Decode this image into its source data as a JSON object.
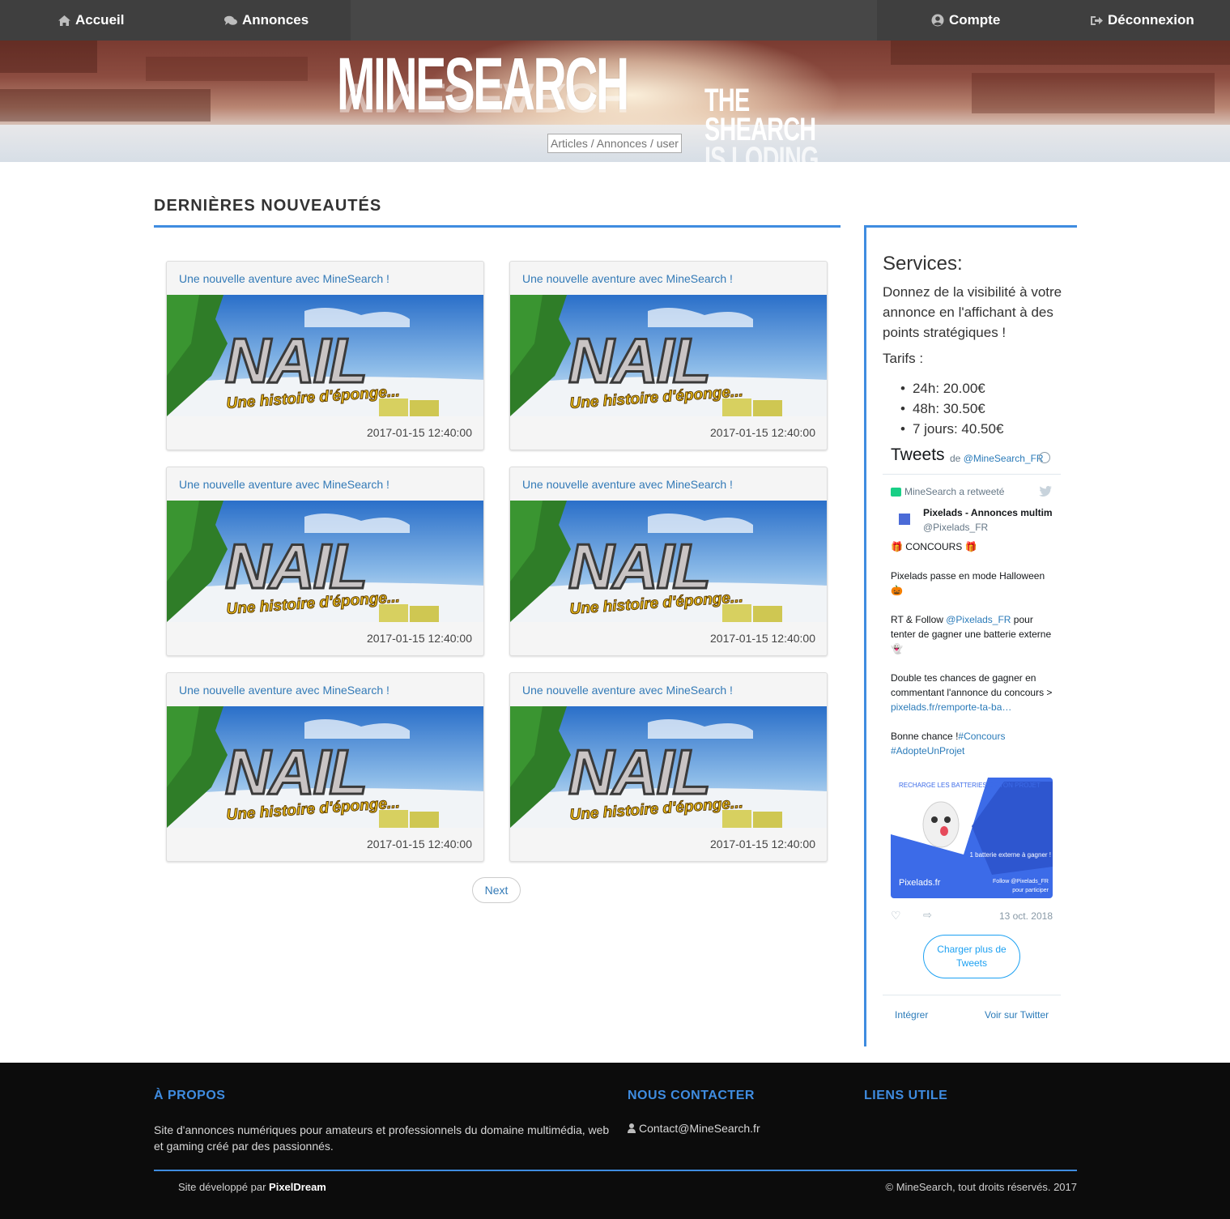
{
  "nav": {
    "home": "Accueil",
    "annonces": "Annonces",
    "compte": "Compte",
    "logout": "Déconnexion"
  },
  "banner": {
    "logo": "MINESEARCH",
    "tagline_1": "THE",
    "tagline_2": "SHEARCH",
    "tagline_3": "IS LODING...",
    "search_placeholder": "Articles / Annonces / user"
  },
  "main": {
    "section_title": "DERNIÈRES NOUVEAUTÉS",
    "cards": [
      {
        "title": "Une nouvelle aventure avec MineSearch !",
        "image_title": "NAIL",
        "image_subtitle": "Une histoire d'éponge...",
        "date": "2017-01-15 12:40:00"
      },
      {
        "title": "Une nouvelle aventure avec MineSearch !",
        "image_title": "NAIL",
        "image_subtitle": "Une histoire d'éponge...",
        "date": "2017-01-15 12:40:00"
      },
      {
        "title": "Une nouvelle aventure avec MineSearch !",
        "image_title": "NAIL",
        "image_subtitle": "Une histoire d'éponge...",
        "date": "2017-01-15 12:40:00"
      },
      {
        "title": "Une nouvelle aventure avec MineSearch !",
        "image_title": "NAIL",
        "image_subtitle": "Une histoire d'éponge...",
        "date": "2017-01-15 12:40:00"
      },
      {
        "title": "Une nouvelle aventure avec MineSearch !",
        "image_title": "NAIL",
        "image_subtitle": "Une histoire d'éponge...",
        "date": "2017-01-15 12:40:00"
      },
      {
        "title": "Une nouvelle aventure avec MineSearch !",
        "image_title": "NAIL",
        "image_subtitle": "Une histoire d'éponge...",
        "date": "2017-01-15 12:40:00"
      }
    ],
    "next_label": "Next"
  },
  "sidebar": {
    "title": "Services:",
    "description": "Donnez de la visibilité à votre annonce en l'affichant à des points stratégiques !",
    "tarifs_label": "Tarifs :",
    "tarifs": [
      "24h: 20.00€",
      "48h: 30.50€",
      "7 jours: 40.50€"
    ],
    "twitter": {
      "header": "Tweets",
      "by_prefix": "de",
      "by_handle": "@MineSearch_FR",
      "retweet_label": "MineSearch a retweeté",
      "author_name": "Pixelads - Annonces multim",
      "author_handle": "@Pixelads_FR",
      "line1": "🎁 CONCOURS 🎁",
      "line2": "Pixelads passe en mode Halloween 🎃",
      "line3_a": "RT & Follow ",
      "line3_link": "@Pixelads_FR",
      "line3_b": " pour tenter de gagner une batterie externe 👻",
      "line4_a": "Double tes chances de gagner en commentant l'annonce du concours > ",
      "line4_link": "pixelads.fr/remporte-ta-ba…",
      "line5_a": "Bonne chance !",
      "line5_link1": "#Concours",
      "line5_link2": "#AdopteUnProjet",
      "media_top": "RECHARGE LES BATTERIES DE TON PROJET",
      "media_prize": "1 batterie externe à gagner !",
      "media_brand": "Pixelads.fr",
      "media_follow": "Follow @Pixelads_FR",
      "media_participate": "pour participer",
      "date": "13 oct. 2018",
      "load_more": "Charger plus de Tweets",
      "embed": "Intégrer",
      "view_on": "Voir sur Twitter"
    }
  },
  "footer": {
    "about_title": "À PROPOS",
    "about_text": "Site d'annonces numériques pour amateurs et professionnels du domaine multimédia, web et gaming créé par des passionnés.",
    "contact_title": "NOUS CONTACTER",
    "contact_email": "Contact@MineSearch.fr",
    "links_title": "LIENS UTILE",
    "dev_prefix": "Site développé par ",
    "dev_name": "PixelDream",
    "copyright": "© MineSearch, tout droits réservés. 2017"
  },
  "colors": {
    "accent": "#3f8ce0",
    "nav_bg": "#3f3f3f",
    "link": "#337ab7",
    "footer_bg": "#0c0c0c",
    "twitter_blue": "#1da1f2"
  }
}
